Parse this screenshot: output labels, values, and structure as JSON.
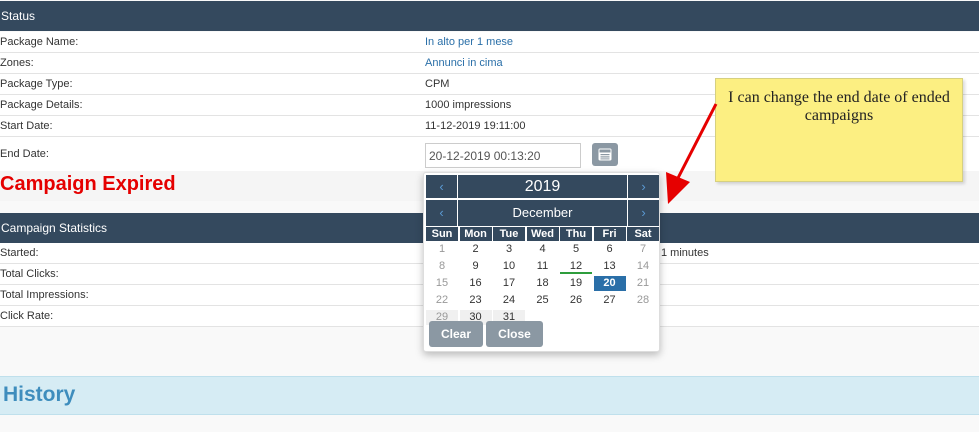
{
  "status": {
    "title": "Status",
    "rows": [
      {
        "label": "Package Name:",
        "value": "In alto per 1 mese"
      },
      {
        "label": "Zones:",
        "value": "Annunci in cima"
      },
      {
        "label": "Package Type:",
        "value": "CPM"
      },
      {
        "label": "Package Details:",
        "value": "1000 impressions"
      },
      {
        "label": "Start Date:",
        "value": "11-12-2019 19:11:00"
      },
      {
        "label": "End Date:",
        "value": ""
      }
    ],
    "end_date_value": "20-12-2019 00:13:20"
  },
  "expired_text": "Campaign Expired",
  "stats": {
    "title": "Campaign Statistics",
    "rows": [
      {
        "label": "Started:",
        "value": "1 minutes"
      },
      {
        "label": "Total Clicks:",
        "value": ""
      },
      {
        "label": "Total Impressions:",
        "value": ""
      },
      {
        "label": "Click Rate:",
        "value": ""
      }
    ]
  },
  "history_title": "History",
  "note_text": "I can change the end date of ended campaigns",
  "datepicker": {
    "year": "2019",
    "month": "December",
    "prev": "‹",
    "next": "›",
    "weekdays": [
      "Sun",
      "Mon",
      "Tue",
      "Wed",
      "Thu",
      "Fri",
      "Sat"
    ],
    "weeks": [
      [
        "1",
        "2",
        "3",
        "4",
        "5",
        "6",
        "7"
      ],
      [
        "8",
        "9",
        "10",
        "11",
        "12",
        "13",
        "14"
      ],
      [
        "15",
        "16",
        "17",
        "18",
        "19",
        "20",
        "21"
      ],
      [
        "22",
        "23",
        "24",
        "25",
        "26",
        "27",
        "28"
      ],
      [
        "29",
        "30",
        "31",
        "",
        "",
        "",
        ""
      ]
    ],
    "today": "12",
    "selected": "20",
    "clear_label": "Clear",
    "close_label": "Close"
  },
  "colors": {
    "header_bg": "#34495e",
    "expired": "#e50000",
    "selected": "#2a6fa8",
    "note_bg": "#fcef82",
    "arrow": "#e60000"
  },
  "icons": {
    "calendar_button": "calendar-icon"
  }
}
